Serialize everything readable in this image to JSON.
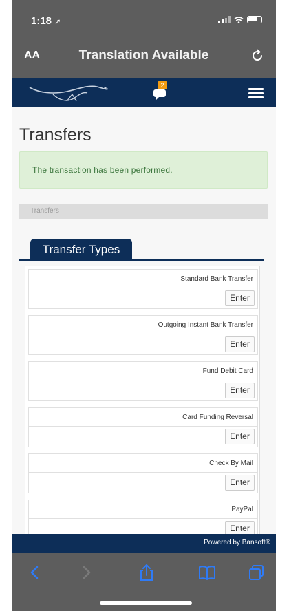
{
  "status_bar": {
    "time": "1:18"
  },
  "browser": {
    "aa_label": "AA",
    "title": "Translation Available"
  },
  "site_header": {
    "chat_badge": "2"
  },
  "page": {
    "title": "Transfers",
    "alert": "The transaction has been performed.",
    "breadcrumb": "Transfers",
    "tab_label": "Transfer Types"
  },
  "transfer_types": [
    {
      "name": "Standard Bank Transfer",
      "action": "Enter"
    },
    {
      "name": "Outgoing Instant Bank Transfer",
      "action": "Enter"
    },
    {
      "name": "Fund Debit Card",
      "action": "Enter"
    },
    {
      "name": "Card Funding Reversal",
      "action": "Enter"
    },
    {
      "name": "Check By Mail",
      "action": "Enter"
    },
    {
      "name": "PayPal",
      "action": "Enter"
    }
  ],
  "footer": {
    "powered_by": "Powered by Bansoft®"
  },
  "colors": {
    "brand_navy": "#0d2e58",
    "safari_gray": "#5d5d5d",
    "alert_bg": "#dff0d8",
    "alert_text": "#3c763d",
    "badge": "#f39c12",
    "toolbar_blue": "#2f7bf6"
  },
  "icons": {
    "reload": "reload-icon",
    "chat": "chat-icon",
    "menu": "hamburger-menu-icon",
    "back": "chevron-left-icon",
    "forward": "chevron-right-icon",
    "share": "share-icon",
    "bookmarks": "book-icon",
    "tabs": "tabs-icon"
  }
}
